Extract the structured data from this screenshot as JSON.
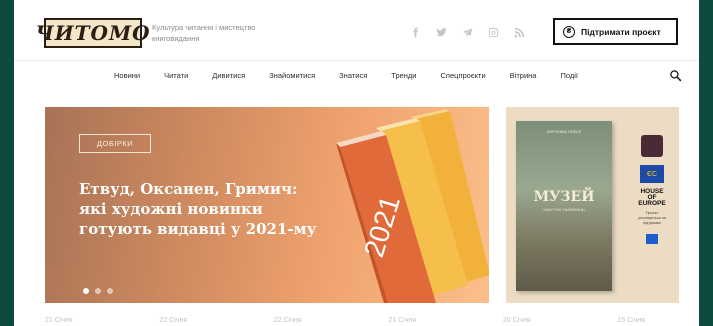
{
  "header": {
    "logo_text": "ЧИТОМО",
    "tagline": "Культура читання і мистецтво книговидання",
    "support_label": "Підтримати проєкт",
    "social_icons": [
      "facebook-icon",
      "twitter-icon",
      "telegram-icon",
      "instagram-icon",
      "rss-icon"
    ]
  },
  "nav": {
    "items": [
      "Новини",
      "Читати",
      "Дивитися",
      "Знайомитися",
      "Знатися",
      "Тренди",
      "Спецпроєкти",
      "Вітрина",
      "Події"
    ]
  },
  "hero": {
    "tag": "ДОБІРКИ",
    "title": "Етвуд, Оксанен, Гримич: які художні новинки готують видавці у 2021-му",
    "book_year": "2021",
    "slide_count": 3,
    "active_slide": 1
  },
  "ad": {
    "book_top": "ВЕРОНІКА  НОВОЇ",
    "book_title": "МУЗЕЙ",
    "book_subtitle": "ЗАБУТИХ ТАЄМНИЦЬ",
    "partner_text": "ЄС",
    "partner_name": "HOUSE OF EUROPE",
    "ad_text": "Проєкт реалізується за підтримки"
  },
  "dates": [
    "21 Січня",
    "22 Січня",
    "22 Січня",
    "21 Січня",
    "20 Січня",
    "15 Січня"
  ],
  "colors": {
    "frame": "#0e4b3f",
    "hero_gradient_start": "#a77356",
    "hero_gradient_end": "#fbbf8c",
    "book_orange": "#e06a3a",
    "book_yellow": "#f5b43c"
  }
}
